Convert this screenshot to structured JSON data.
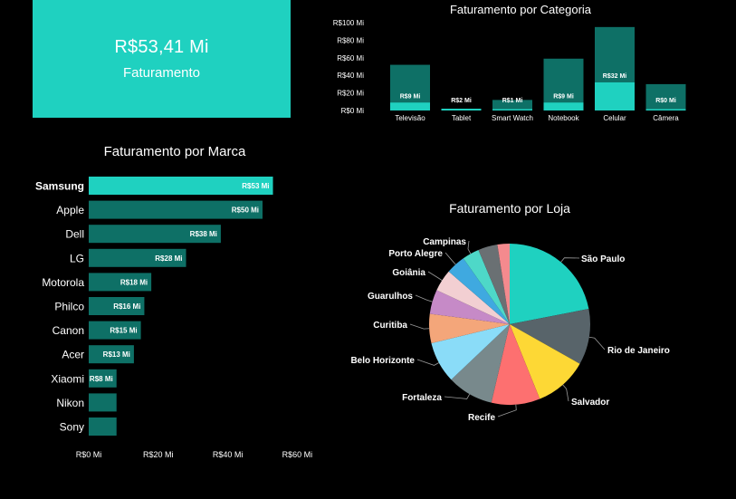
{
  "kpi": {
    "value": "R$53,41 Mi",
    "label": "Faturamento"
  },
  "colors": {
    "background": "#000000",
    "teal_bright": "#1fd1c0",
    "teal_dark": "#0e7066",
    "teal_mid": "#12867a",
    "text": "#ffffff"
  },
  "chart_data": [
    {
      "id": "categoria",
      "type": "bar",
      "orientation": "vertical",
      "title": "Faturamento por Categoria",
      "categories": [
        "Televisão",
        "Tablet",
        "Smart Watch",
        "Notebook",
        "Celular",
        "Câmera"
      ],
      "values": [
        9,
        2,
        1,
        9,
        32,
        0
      ],
      "data_labels": [
        "R$9 Mi",
        "R$2 Mi",
        "R$1 Mi",
        "R$9 Mi",
        "R$32 Mi",
        "R$0 Mi"
      ],
      "background_bar_values": [
        52,
        2,
        12,
        59,
        95,
        30
      ],
      "y_ticks": [
        "R$0 Mi",
        "R$20 Mi",
        "R$40 Mi",
        "R$60 Mi",
        "R$80 Mi",
        "R$100 Mi"
      ],
      "ylim": [
        0,
        100
      ],
      "grid": false
    },
    {
      "id": "marca",
      "type": "bar",
      "orientation": "horizontal",
      "title": "Faturamento por Marca",
      "categories": [
        "Samsung",
        "Apple",
        "Dell",
        "LG",
        "Motorola",
        "Philco",
        "Canon",
        "Acer",
        "Xiaomi",
        "Nikon",
        "Sony"
      ],
      "values": [
        53,
        50,
        38,
        28,
        18,
        16,
        15,
        13,
        8,
        8,
        8
      ],
      "data_labels": [
        "R$53 Mi",
        "R$50 Mi",
        "R$38 Mi",
        "R$28 Mi",
        "R$18 Mi",
        "R$16 Mi",
        "R$15 Mi",
        "R$13 Mi",
        "R$8 Mi",
        "",
        ""
      ],
      "highlight": "Samsung",
      "x_ticks": [
        "R$0 Mi",
        "R$20 Mi",
        "R$40 Mi",
        "R$60 Mi"
      ],
      "xlim": [
        0,
        60
      ],
      "grid": false
    },
    {
      "id": "loja",
      "type": "pie",
      "title": "Faturamento por Loja",
      "labels": [
        "São Paulo",
        "Rio de Janeiro",
        "Salvador",
        "Recife",
        "Fortaleza",
        "Belo Horizonte",
        "Curitiba",
        "Guarulhos",
        "Goiânia",
        "Porto Alegre",
        "Campinas",
        ""
      ],
      "values": [
        22.5,
        11.5,
        11,
        10,
        9.5,
        8.5,
        6,
        5,
        4.5,
        4,
        3.5,
        4
      ],
      "colors": [
        "#1fd1c0",
        "#58646a",
        "#fdd835",
        "#fd7070",
        "#78898c",
        "#8adcf8",
        "#f4a67a",
        "#c68ac7",
        "#f2cfd2",
        "#3fa9e0",
        "#4ed8c8",
        "#6a7073"
      ],
      "extra_slices": [
        "#f48a8e"
      ],
      "extra_values": [
        2.5
      ]
    }
  ]
}
